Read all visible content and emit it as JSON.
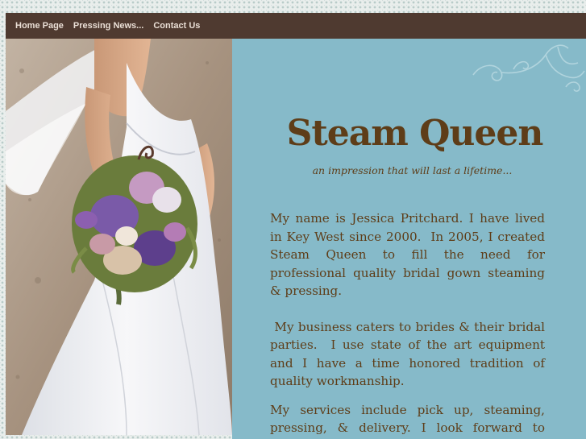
{
  "nav": {
    "items": [
      {
        "label": "Home Page"
      },
      {
        "label": "Pressing News..."
      },
      {
        "label": "Contact Us"
      }
    ]
  },
  "photo": {
    "description_icon": "bride-with-bouquet-image"
  },
  "header": {
    "title": "Steam Queen",
    "tagline": "an impression that will last a lifetime..."
  },
  "content": {
    "paragraphs": [
      "My name is Jessica Pritchard. I have lived in Key West since 2000.  In 2005, I created Steam Queen to fill the need for professional quality bridal gown steaming & pressing.",
      " My business caters to brides & their bridal parties.  I use state of the art equipment and I have a time honored tradition of quality workmanship.",
      "My services include pick up, steaming, pressing, & delivery. I look forward to working with you!"
    ]
  },
  "colors": {
    "navbar": "#4f3a30",
    "nav_text": "#eadfd6",
    "content_bg": "#86bac9",
    "text_brown": "#5e3d18",
    "pattern_bg": "#e9eeec"
  }
}
